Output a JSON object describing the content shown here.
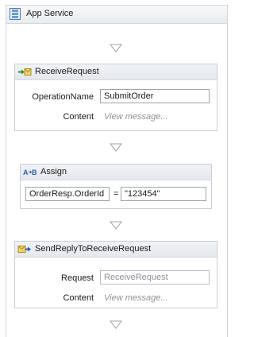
{
  "sequence": {
    "title": "App Service",
    "icon": "app-service-icon"
  },
  "receive": {
    "title": "ReceiveRequest",
    "icon": "receive-icon",
    "operation_label": "OperationName",
    "operation_value": "SubmitOrder",
    "content_label": "Content",
    "content_hint": "View message..."
  },
  "assign": {
    "title": "Assign",
    "icon": "assign-icon",
    "to_value": "OrderResp.OrderId",
    "equals": "=",
    "value": "\"123454\""
  },
  "send": {
    "title": "SendReplyToReceiveRequest",
    "icon": "send-reply-icon",
    "request_label": "Request",
    "request_value": "ReceiveRequest",
    "content_label": "Content",
    "content_hint": "View message..."
  },
  "colors": {
    "border": "#c9ced6",
    "header": "#e9ecf0",
    "hint": "#8c9196",
    "drop_arrow": "#9aa3ad"
  }
}
